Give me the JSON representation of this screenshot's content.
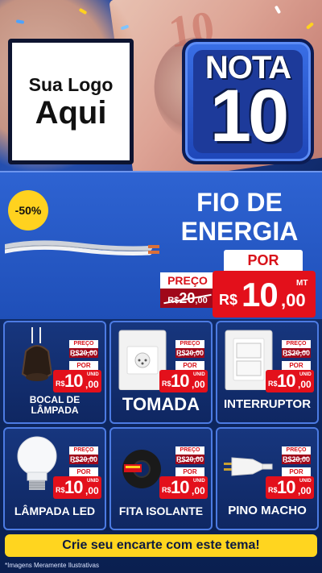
{
  "hero": {
    "bill_denomination": "10",
    "logo": {
      "line1": "Sua Logo",
      "line2": "Aqui"
    },
    "badge": {
      "word": "NOTA",
      "number": "10"
    }
  },
  "featured": {
    "discount": "-50%",
    "title_line1": "FIO DE",
    "title_line2": "ENERGIA",
    "por_label": "POR",
    "preco_label": "PREÇO",
    "old_currency": "R$",
    "old_int": "20",
    "old_dec": ",00",
    "currency": "R$",
    "price_int": "10",
    "price_dec": ",00",
    "unit": "MT"
  },
  "products": [
    {
      "name_line1": "BOCAL DE",
      "name_line2": "LÂMPADA",
      "preco_label": "PREÇO",
      "old_price": "R$20,00",
      "por_label": "POR",
      "currency": "R$",
      "price_int": "10",
      "price_dec": ",00",
      "unit": "UNID"
    },
    {
      "name_line1": "TOMADA",
      "name_line2": "",
      "preco_label": "PREÇO",
      "old_price": "R$20,00",
      "por_label": "POR",
      "currency": "R$",
      "price_int": "10",
      "price_dec": ",00",
      "unit": "UNID"
    },
    {
      "name_line1": "INTERRUPTOR",
      "name_line2": "",
      "preco_label": "PREÇO",
      "old_price": "R$20,00",
      "por_label": "POR",
      "currency": "R$",
      "price_int": "10",
      "price_dec": ",00",
      "unit": "UNID"
    },
    {
      "name_line1": "LÂMPADA LED",
      "name_line2": "",
      "preco_label": "PREÇO",
      "old_price": "R$20,00",
      "por_label": "POR",
      "currency": "R$",
      "price_int": "10",
      "price_dec": ",00",
      "unit": "UNID"
    },
    {
      "name_line1": "FITA ISOLANTE",
      "name_line2": "",
      "preco_label": "PREÇO",
      "old_price": "R$20,00",
      "por_label": "POR",
      "currency": "R$",
      "price_int": "10",
      "price_dec": ",00",
      "unit": "UNID"
    },
    {
      "name_line1": "PINO MACHO",
      "name_line2": "",
      "preco_label": "PREÇO",
      "old_price": "R$20,00",
      "por_label": "POR",
      "currency": "R$",
      "price_int": "10",
      "price_dec": ",00",
      "unit": "UNID"
    }
  ],
  "cta": {
    "label": "Crie seu encarte com este tema!"
  },
  "disclaimer": "*Imagens Meramente Ilustrativas",
  "colors": {
    "price_red": "#e3101b",
    "old_price_red": "#a0081a",
    "cta_yellow": "#ffd51f",
    "panel_blue": "#1f4fb8"
  }
}
